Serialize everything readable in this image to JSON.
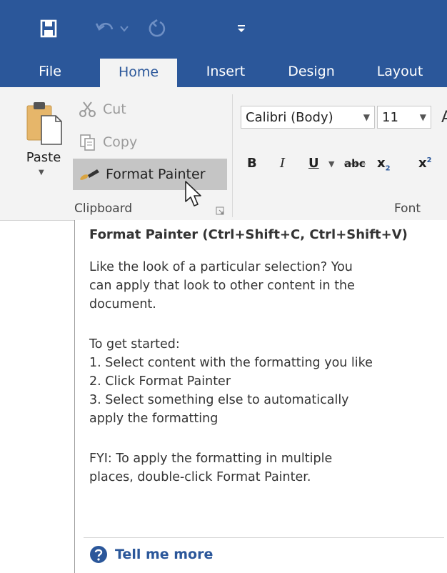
{
  "qat": {
    "items": [
      {
        "icon": "save-icon"
      },
      {
        "icon": "undo-icon"
      },
      {
        "icon": "redo-icon"
      },
      {
        "icon": "customize-qat-icon"
      }
    ]
  },
  "tabs": [
    {
      "label": "File"
    },
    {
      "label": "Home",
      "active": true
    },
    {
      "label": "Insert"
    },
    {
      "label": "Design"
    },
    {
      "label": "Layout"
    }
  ],
  "clipboard": {
    "paste_label": "Paste",
    "cut_label": "Cut",
    "copy_label": "Copy",
    "format_painter_label": "Format Painter",
    "group_label": "Clipboard"
  },
  "font": {
    "font_name": "Calibri (Body)",
    "font_size": "11",
    "bold": "B",
    "italic": "I",
    "underline": "U",
    "strike": "abc",
    "subscript": "x",
    "subscript_suffix": "2",
    "superscript": "x",
    "superscript_suffix": "2",
    "group_label": "Font"
  },
  "tooltip": {
    "title": "Format Painter (Ctrl+Shift+C, Ctrl+Shift+V)",
    "lines": [
      "Like the look of a particular selection? You",
      "can apply that look to other content in the",
      "document.",
      "",
      "To get started:",
      "1. Select content with the formatting you like",
      "2. Click Format Painter",
      "3. Select something else to automatically",
      "apply the formatting",
      "",
      "FYI: To apply the formatting in multiple",
      "places, double-click Format Painter."
    ],
    "tell_me_more": "Tell me more"
  },
  "colors": {
    "brand": "#2b579a",
    "ribbon": "#f3f3f3",
    "highlight": "#c5c5c5"
  }
}
